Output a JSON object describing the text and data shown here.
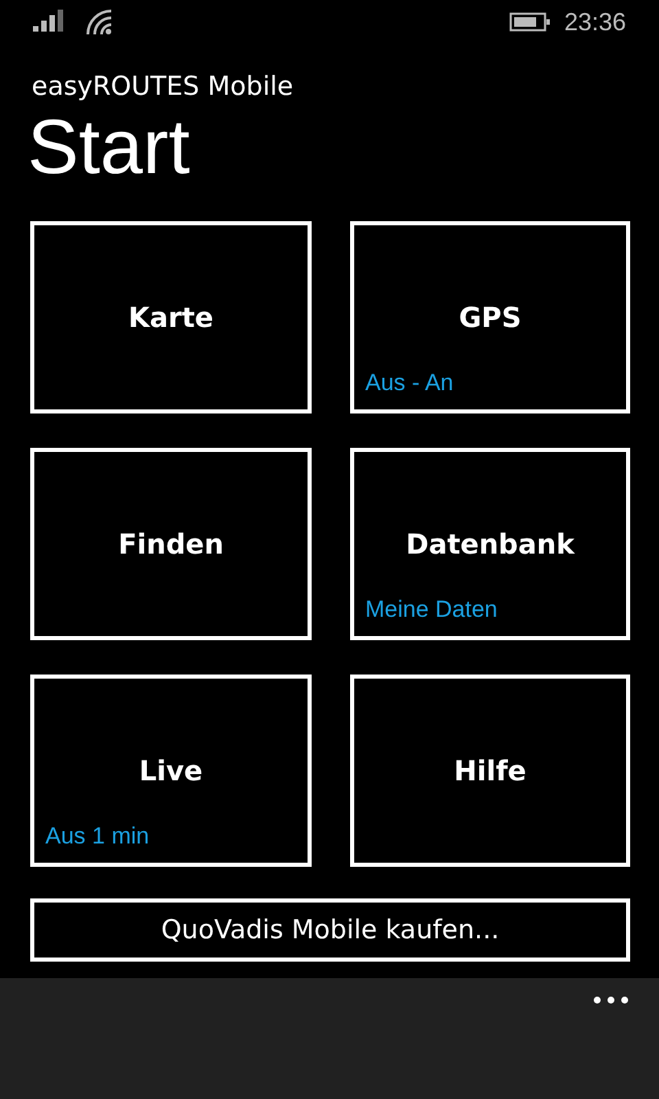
{
  "status_bar": {
    "time": "23:36"
  },
  "app_title": "easyROUTES Mobile",
  "page_title": "Start",
  "tiles": [
    {
      "label": "Karte"
    },
    {
      "label": "GPS",
      "subtitle": "Aus - An"
    },
    {
      "label": "Finden"
    },
    {
      "label": "Datenbank",
      "subtitle": "Meine Daten"
    },
    {
      "label": "Live",
      "subtitle": "Aus 1 min"
    },
    {
      "label": "Hilfe"
    }
  ],
  "buy_button": "QuoVadis Mobile kaufen..."
}
